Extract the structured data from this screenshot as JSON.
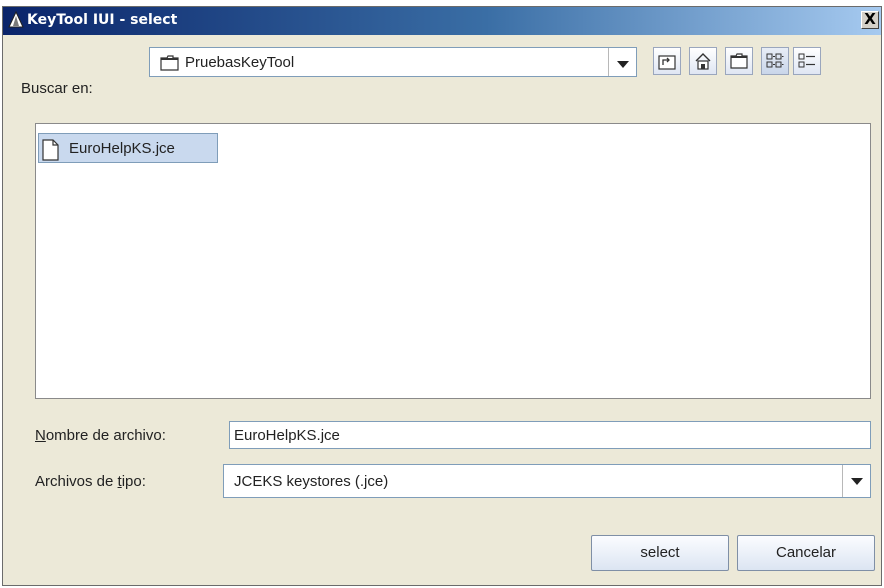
{
  "window": {
    "title": "KeyTool IUI - select",
    "close_glyph": "X"
  },
  "lookin": {
    "label": "Buscar en:",
    "value": "PruebasKeyTool"
  },
  "toolbar": {
    "buttons": [
      {
        "name": "up-one-level-icon"
      },
      {
        "name": "home-icon"
      },
      {
        "name": "new-folder-icon"
      },
      {
        "name": "list-view-icon"
      },
      {
        "name": "details-view-icon"
      }
    ]
  },
  "files": [
    {
      "name": "EuroHelpKS.jce",
      "icon": "file-icon",
      "selected": true
    }
  ],
  "filename": {
    "label_mnemonic": "N",
    "label_rest": "ombre de archivo:",
    "value": "EuroHelpKS.jce"
  },
  "filetype": {
    "label_pre": "Archivos de ",
    "label_mnemonic": "t",
    "label_post": "ipo:",
    "value": "JCEKS keystores (.jce)"
  },
  "buttons": {
    "select": "select",
    "cancel": "Cancelar"
  },
  "colors": {
    "titlebar_start": "#0a246a",
    "titlebar_end": "#a6caf0",
    "selection": "#c9d9ee"
  }
}
